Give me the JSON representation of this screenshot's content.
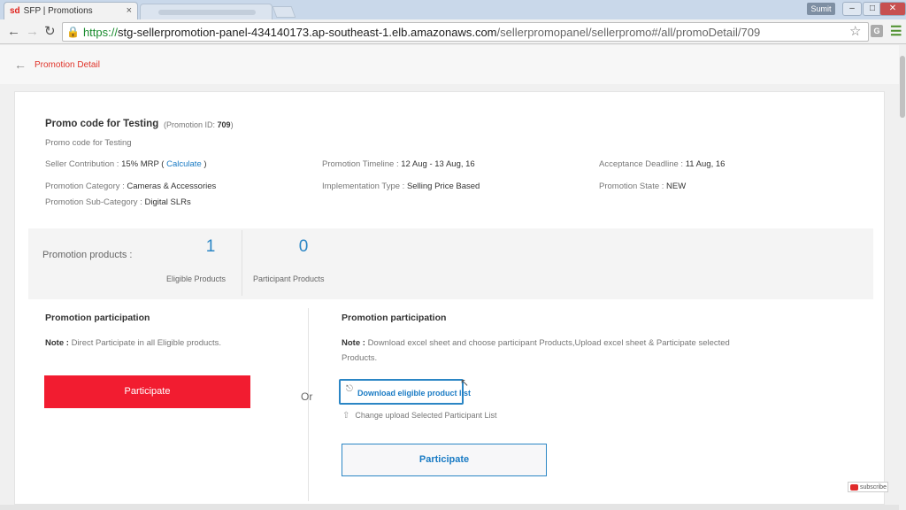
{
  "browser": {
    "tab_favicon": "sd",
    "tab_title": "SFP | Promotions",
    "tab_close": "×",
    "user_name": "Sumit",
    "window_buttons": [
      "–",
      "□",
      "✕"
    ],
    "url_scheme": "https://",
    "url_host": "stg-sellerpromotion-panel-434140173.ap-southeast-1.elb.amazonaws.com",
    "url_path": "/sellerpromopanel/sellerpromo#/all/promoDetail/709",
    "ext_label": "G"
  },
  "header": {
    "back_icon": "←",
    "title": "Promotion Detail"
  },
  "promo": {
    "name": "Promo code for Testing",
    "id_label": "(Promotion ID: ",
    "id_value": "709",
    "id_suffix": ")",
    "description": "Promo code for Testing"
  },
  "fields": {
    "seller_contribution_label": "Seller Contribution : ",
    "seller_contribution_value": "15% MRP",
    "calculate_open": " ( ",
    "calculate_link": "Calculate",
    "calculate_close": " )",
    "timeline_label": "Promotion Timeline : ",
    "timeline_value": "12 Aug - 13 Aug, 16",
    "deadline_label": "Acceptance Deadline : ",
    "deadline_value": "11 Aug, 16",
    "category_label": "Promotion Category : ",
    "category_value": "Cameras & Accessories",
    "impl_label": "Implementation Type : ",
    "impl_value": "Selling Price Based",
    "state_label": "Promotion State : ",
    "state_value": "NEW",
    "subcategory_label": "Promotion Sub-Category : ",
    "subcategory_value": "Digital SLRs"
  },
  "stats": {
    "label": "Promotion products :",
    "eligible_count": "1",
    "eligible_caption": "Eligible Products",
    "participant_count": "0",
    "participant_caption": "Participant Products"
  },
  "left_panel": {
    "title": "Promotion participation",
    "note_label": "Note : ",
    "note_text": "Direct Participate in all Eligible products.",
    "button": "Participate"
  },
  "or_label": "Or",
  "right_panel": {
    "title": "Promotion participation",
    "note_label": "Note : ",
    "note_line1": "Download excel sheet and choose participant Products,Upload excel sheet & Participate selected",
    "note_line2": "Products.",
    "download_label": "Download eligible product list",
    "upload_label": "Change upload Selected Participant List",
    "button": "Participate"
  },
  "overlay": {
    "subscribe": "subscribe"
  },
  "colors": {
    "accent_red": "#f21c30",
    "link_blue": "#1a7bc4",
    "stat_blue": "#2b86c5"
  }
}
